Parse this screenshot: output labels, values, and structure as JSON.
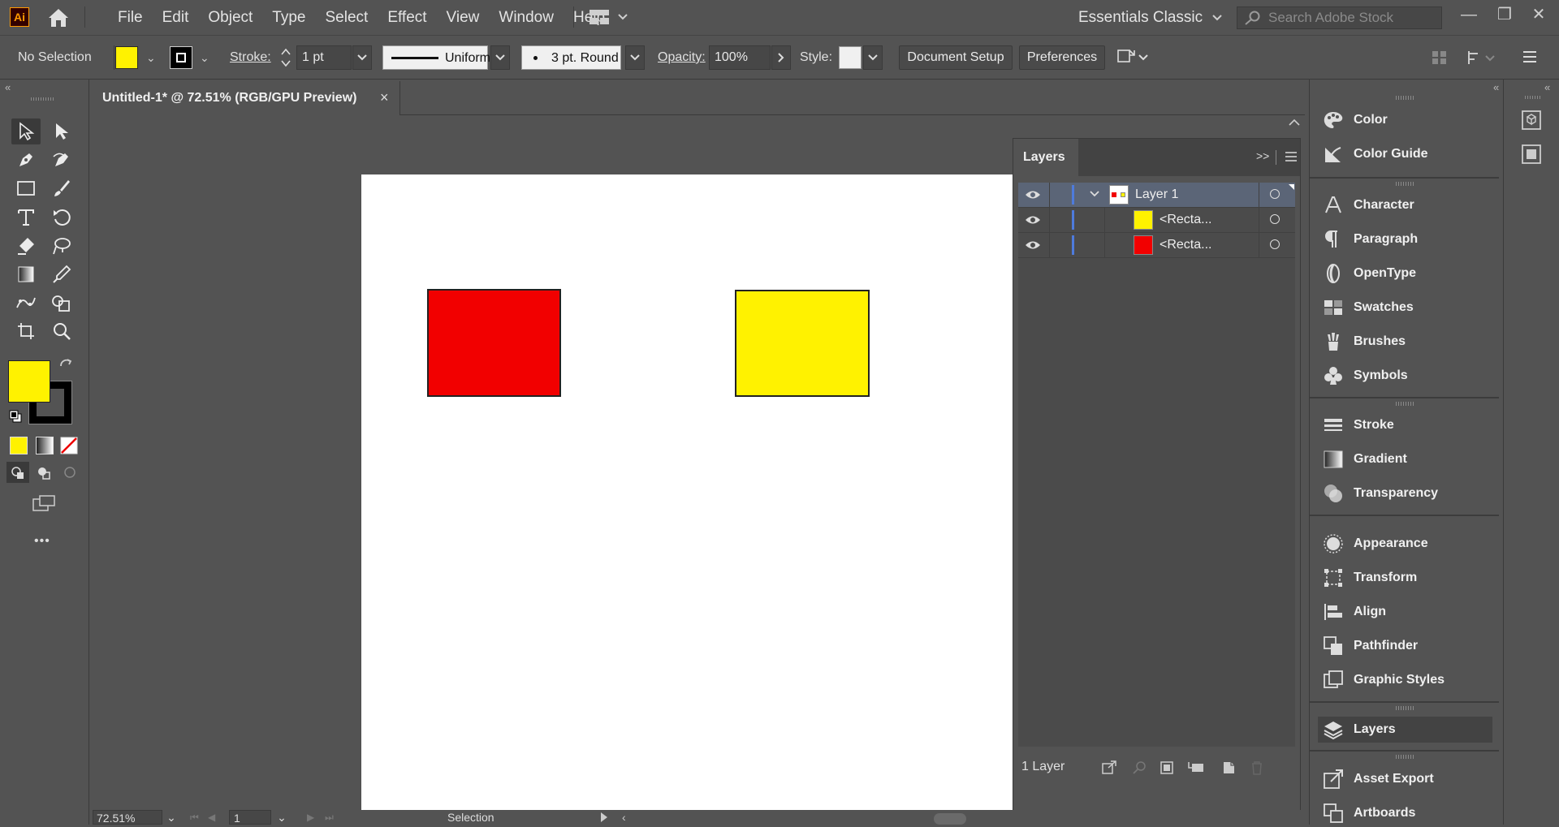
{
  "app": {
    "logo_text": "Ai"
  },
  "menu": [
    "File",
    "Edit",
    "Object",
    "Type",
    "Select",
    "Effect",
    "View",
    "Window",
    "Help"
  ],
  "workspace": {
    "label": "Essentials Classic"
  },
  "search": {
    "placeholder": "Search Adobe Stock"
  },
  "control_bar": {
    "selection_status": "No Selection",
    "fill_color": "#fff200",
    "stroke_label": "Stroke:",
    "stroke_weight": "1 pt",
    "stroke_profile": "Uniform",
    "brush": "3 pt. Round",
    "opacity_label": "Opacity:",
    "opacity_value": "100%",
    "style_label": "Style:",
    "document_setup": "Document Setup",
    "preferences": "Preferences"
  },
  "document": {
    "tab_title": "Untitled-1* @ 72.51% (RGB/GPU Preview)",
    "close": "×"
  },
  "artboard": {
    "objects": [
      {
        "type": "rectangle",
        "fill": "#f20000"
      },
      {
        "type": "rectangle",
        "fill": "#fff200"
      }
    ]
  },
  "toolbar": {
    "fill_color": "#fff200",
    "stroke_color": "#000000",
    "more": "•••"
  },
  "layers_panel": {
    "title": "Layers",
    "expand": ">>",
    "rows": [
      {
        "name": "Layer 1",
        "thumb": "layer"
      },
      {
        "name": "<Recta...",
        "thumb_color": "#fff200"
      },
      {
        "name": "<Recta...",
        "thumb_color": "#f20000"
      }
    ],
    "footer_count": "1 Layer"
  },
  "dock": {
    "groups": [
      [
        "Color",
        "Color Guide"
      ],
      [
        "Character",
        "Paragraph",
        "OpenType",
        "Swatches",
        "Brushes",
        "Symbols"
      ],
      [
        "Stroke",
        "Gradient",
        "Transparency"
      ],
      [
        "Appearance",
        "Transform",
        "Align",
        "Pathfinder",
        "Graphic Styles"
      ],
      [
        "Layers"
      ],
      [
        "Asset Export",
        "Artboards"
      ]
    ],
    "active": "Layers"
  },
  "status_bar": {
    "zoom": "72.51%",
    "artboard_number": "1",
    "tool": "Selection"
  }
}
